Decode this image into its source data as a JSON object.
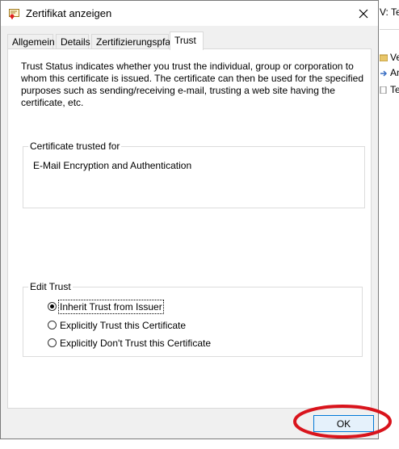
{
  "background_window": {
    "title": "V: Te",
    "items": [
      {
        "label": "Ve",
        "icon": "folder-icon"
      },
      {
        "label": "An",
        "icon": "arrow-icon"
      },
      {
        "label": "Te",
        "icon": "document-icon"
      }
    ]
  },
  "dialog": {
    "title": "Zertifikat anzeigen",
    "tabs": [
      "Allgemein",
      "Details",
      "Zertifizierungspfad",
      "Trust"
    ],
    "active_tab": "Trust",
    "description": "Trust Status indicates whether you trust the individual, group or corporation to whom this certificate is issued.  The certificate can then be used for the specified purposes such as sending/receiving e-mail, trusting a web site having the certificate, etc.",
    "certificate_trusted_for": {
      "legend": "Certificate trusted for",
      "purpose": "E-Mail Encryption and Authentication"
    },
    "edit_trust": {
      "legend": "Edit Trust",
      "options": [
        {
          "label": "Inherit Trust from Issuer",
          "selected": true
        },
        {
          "label": "Explicitly Trust this Certificate",
          "selected": false
        },
        {
          "label": "Explicitly Don't Trust this Certificate",
          "selected": false
        }
      ]
    },
    "ok_label": "OK"
  },
  "annotation_color": "#d9141c"
}
